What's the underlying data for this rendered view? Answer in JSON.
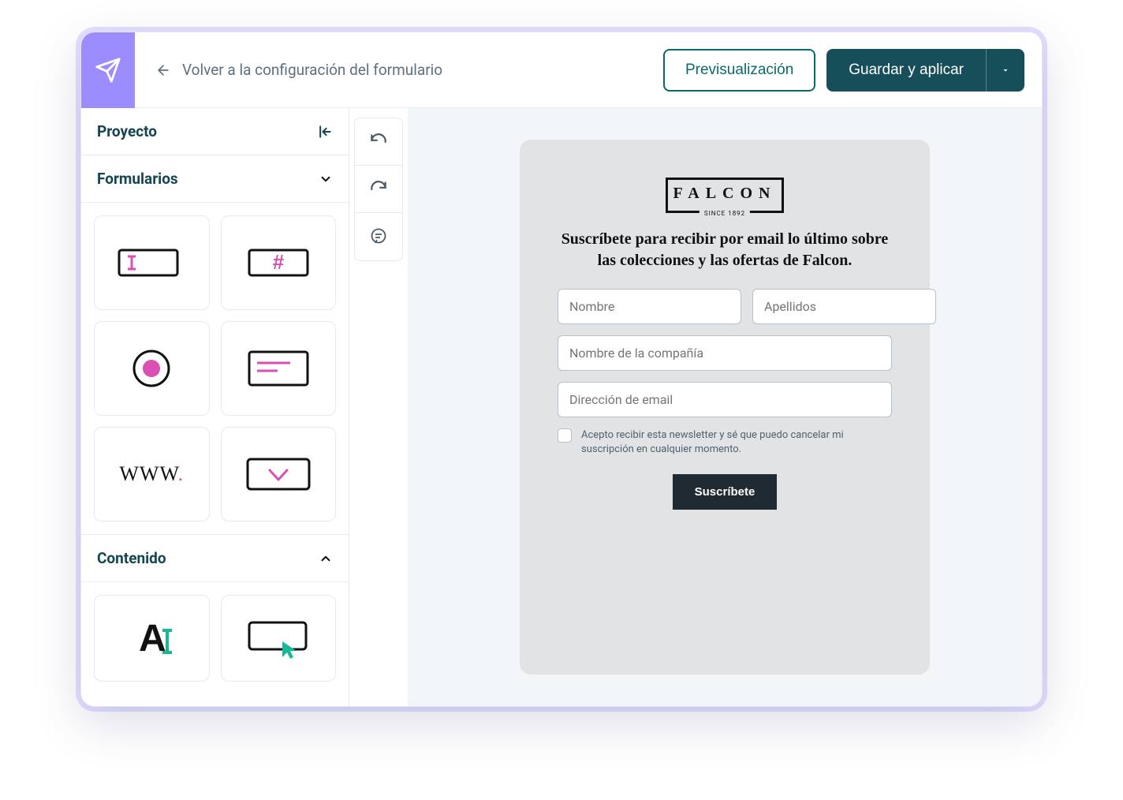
{
  "header": {
    "back_label": "Volver a la configuración del formulario",
    "preview_label": "Previsualización",
    "save_label": "Guardar y aplicar"
  },
  "sidebar": {
    "project_label": "Proyecto",
    "forms_label": "Formularios",
    "content_label": "Contenido"
  },
  "palette_icons": {
    "text_input": "text-input-icon",
    "number_input": "number-input-icon",
    "radio": "radio-icon",
    "textarea": "textarea-icon",
    "url": "url-icon",
    "dropdown": "dropdown-icon",
    "text_block": "text-block-icon",
    "button_block": "button-block-icon"
  },
  "brand": {
    "name": "FALCON",
    "since": "SINCE 1892"
  },
  "form": {
    "heading": "Suscríbete para recibir por email lo último sobre las colecciones y las ofertas de Falcon.",
    "first_name_placeholder": "Nombre",
    "last_name_placeholder": "Apellidos",
    "company_placeholder": "Nombre de la compañía",
    "email_placeholder": "Dirección de email",
    "consent_text": "Acepto recibir esta newsletter y sé que puedo cancelar mi suscripción en cualquier momento.",
    "submit_label": "Suscríbete"
  }
}
